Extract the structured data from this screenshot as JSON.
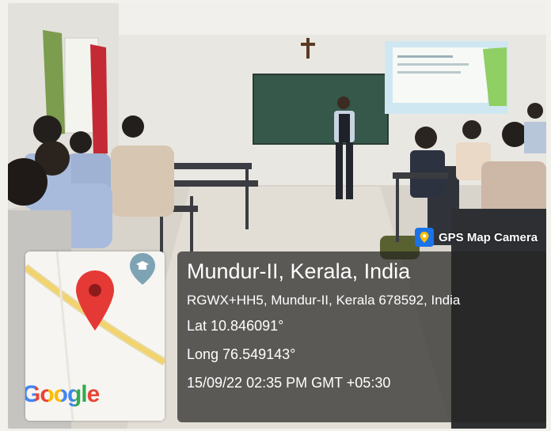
{
  "overlay": {
    "app_name": "GPS Map Camera",
    "location_title": "Mundur-II, Kerala, India",
    "address": "RGWX+HH5, Mundur-II, Kerala 678592, India",
    "latitude": "Lat 10.846091°",
    "longitude": "Long 76.549143°",
    "timestamp": "15/09/22 02:35 PM GMT +05:30"
  },
  "map": {
    "brand": "Google",
    "icons": [
      "location-pin-icon",
      "education-marker-icon",
      "gps-map-camera-logo-icon"
    ]
  },
  "colors": {
    "pin": "#e53935",
    "road": "#f3d36b",
    "panel": "#262622",
    "google_blue": "#4285f4",
    "google_red": "#ea4335",
    "google_yellow": "#fbbc05",
    "google_green": "#34a853"
  }
}
